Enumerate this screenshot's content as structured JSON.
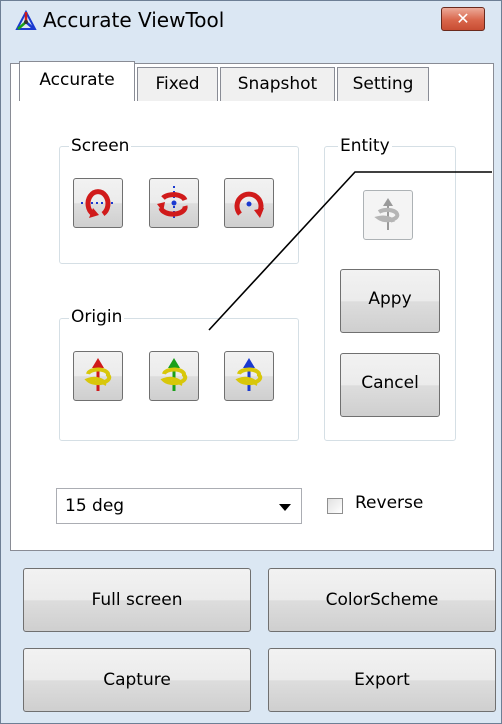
{
  "window": {
    "title": "Accurate ViewTool",
    "close_label": "✕"
  },
  "tabs": [
    {
      "label": "Accurate",
      "active": true
    },
    {
      "label": "Fixed",
      "active": false
    },
    {
      "label": "Snapshot",
      "active": false
    },
    {
      "label": "Setting",
      "active": false
    }
  ],
  "screen_group": {
    "label": "Screen",
    "buttons": [
      "rotate-screen-x-icon",
      "rotate-screen-y-icon",
      "rotate-screen-z-icon"
    ]
  },
  "entity_group": {
    "label": "Entity",
    "apply_label": "Appy",
    "cancel_label": "Cancel"
  },
  "origin_group": {
    "label": "Origin",
    "buttons": [
      "rotate-origin-x-icon",
      "rotate-origin-y-icon",
      "rotate-origin-z-icon"
    ],
    "axis_colors": [
      "#d01a1a",
      "#1aa01a",
      "#1a3ad0"
    ]
  },
  "angle": {
    "value": "15 deg"
  },
  "reverse": {
    "label": "Reverse",
    "checked": false
  },
  "bottom_buttons": {
    "full_screen": "Full screen",
    "color_scheme": "ColorScheme",
    "capture": "Capture",
    "export": "Export"
  }
}
